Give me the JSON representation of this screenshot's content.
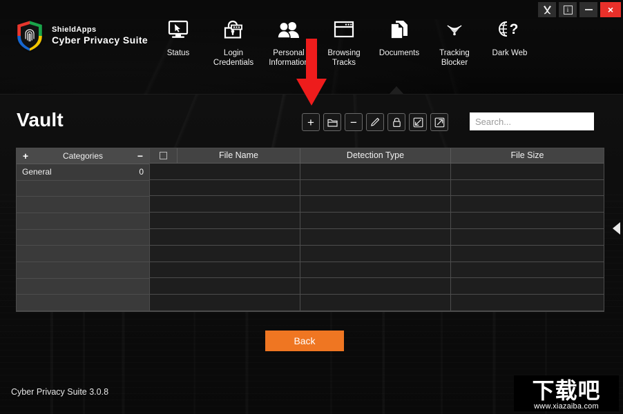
{
  "titlebar": {
    "buttons": [
      {
        "name": "tools",
        "icon": "wrench-screwdriver-icon",
        "label": ""
      },
      {
        "name": "info",
        "icon": "info-icon",
        "label": "i"
      },
      {
        "name": "minimize",
        "icon": "minimize-icon",
        "label": ""
      },
      {
        "name": "close",
        "icon": "close-icon",
        "label": "×"
      }
    ],
    "close_color": "#e8302a"
  },
  "brand": {
    "top": "ShieldApps",
    "bottom": "Cyber Privacy Suite",
    "logo_icon": "shield-fingerprint-logo",
    "logo_colors": [
      "#e8362d",
      "#1aa44a",
      "#1666d0",
      "#f2c500"
    ]
  },
  "nav": {
    "items": [
      {
        "label": "Status",
        "icon": "monitor-icon"
      },
      {
        "label": "Login\nCredentials",
        "icon": "padlock-password-icon"
      },
      {
        "label": "Personal\nInformation",
        "icon": "people-icon"
      },
      {
        "label": "Browsing\nTracks",
        "icon": "browser-window-icon"
      },
      {
        "label": "Documents",
        "icon": "documents-icon"
      },
      {
        "label": "Tracking\nBlocker",
        "icon": "radar-signal-icon"
      },
      {
        "label": "Dark Web",
        "icon": "globe-question-icon"
      }
    ],
    "selected_index": 4
  },
  "annotation": {
    "arrow_icon": "red-down-arrow",
    "color": "#ee1c1c"
  },
  "page": {
    "title": "Vault"
  },
  "toolbar": {
    "buttons": [
      {
        "name": "add",
        "icon": "plus-icon",
        "label": "+"
      },
      {
        "name": "add-folder",
        "icon": "folder-icon",
        "label": ""
      },
      {
        "name": "remove",
        "icon": "minus-icon",
        "label": "−"
      },
      {
        "name": "edit",
        "icon": "pencil-icon",
        "label": ""
      },
      {
        "name": "lock",
        "icon": "padlock-icon",
        "label": ""
      },
      {
        "name": "import",
        "icon": "import-arrow-icon",
        "label": ""
      },
      {
        "name": "export",
        "icon": "export-arrow-icon",
        "label": ""
      }
    ]
  },
  "search": {
    "placeholder": "Search...",
    "value": ""
  },
  "categories": {
    "header": {
      "add": "+",
      "title": "Categories",
      "remove": "−"
    },
    "rows": [
      {
        "name": "General",
        "count": "0"
      }
    ],
    "empty_row_count": 8
  },
  "file_table": {
    "columns": [
      "File Name",
      "Detection Type",
      "File Size"
    ],
    "select_all_checked": false,
    "rows": [],
    "empty_row_count": 9
  },
  "footer": {
    "back_label": "Back",
    "back_color": "#ef7622",
    "version": "Cyber Privacy Suite 3.0.8"
  },
  "edge_tab": {
    "icon": "collapse-left-arrow-icon"
  },
  "watermark": {
    "text_cn": "下载吧",
    "url": "www.xiazaiba.com"
  }
}
